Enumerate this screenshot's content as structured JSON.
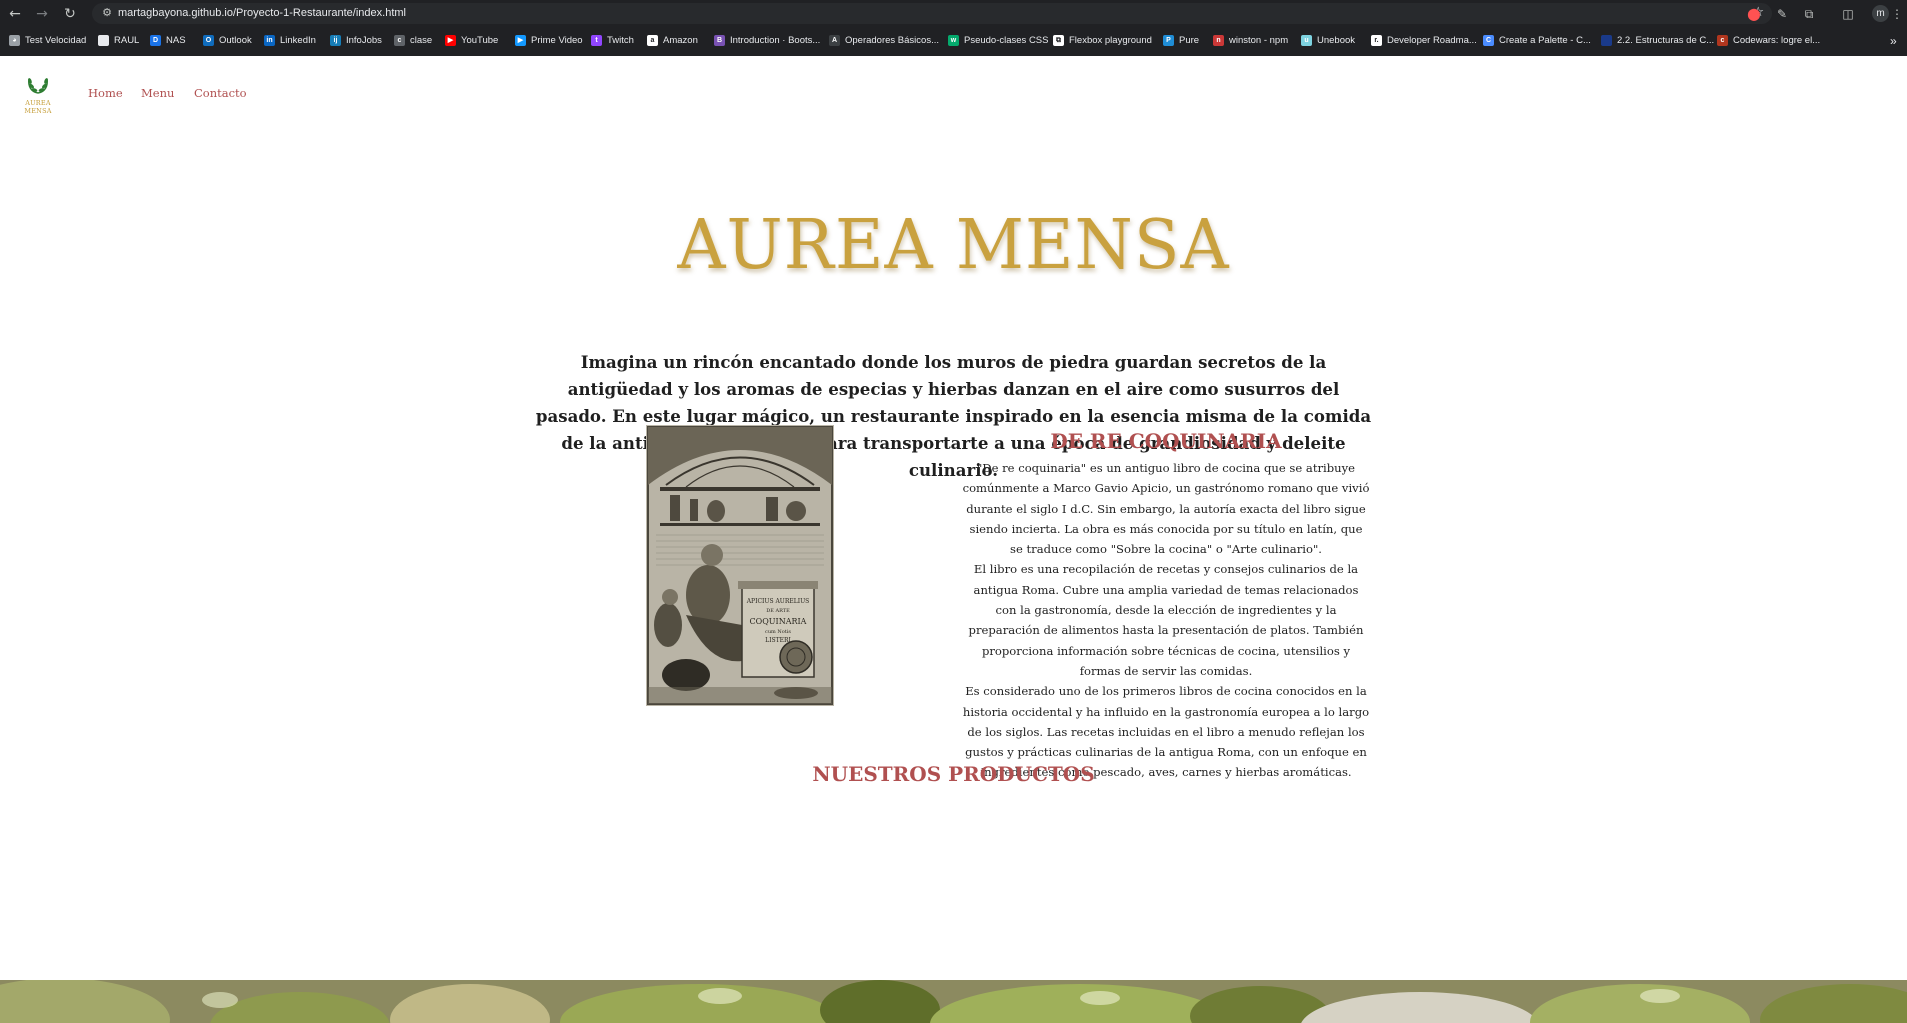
{
  "browser": {
    "url": "martagbayona.github.io/Proyecto-1-Restaurante/index.html",
    "profile_initial": "m",
    "bookmarks": [
      {
        "label": "Test Velocidad",
        "icon": "speedometer-icon",
        "color": "#9aa0a6"
      },
      {
        "label": "RAUL",
        "icon": "folder-icon",
        "color": "#e8eaed"
      },
      {
        "label": "NAS",
        "icon": "nas-icon",
        "color": "#1a73e8"
      },
      {
        "label": "Outlook",
        "icon": "outlook-icon",
        "color": "#0f6cbd"
      },
      {
        "label": "LinkedIn",
        "icon": "linkedin-icon",
        "color": "#0a66c2"
      },
      {
        "label": "InfoJobs",
        "icon": "infojobs-icon",
        "color": "#167db7"
      },
      {
        "label": "clase",
        "icon": "classroom-icon",
        "color": "#5f6368"
      },
      {
        "label": "YouTube",
        "icon": "youtube-icon",
        "color": "#ff0000"
      },
      {
        "label": "Prime Video",
        "icon": "prime-video-icon",
        "color": "#1399ff"
      },
      {
        "label": "Twitch",
        "icon": "twitch-icon",
        "color": "#9146ff"
      },
      {
        "label": "Amazon",
        "icon": "amazon-icon",
        "color": "#ffffff"
      },
      {
        "label": "Introduction · Boots...",
        "icon": "bootstrap-icon",
        "color": "#7952b3"
      },
      {
        "label": "Operadores Básicos...",
        "icon": "operators-icon",
        "color": "#3c4043"
      },
      {
        "label": "Pseudo-clases CSS",
        "icon": "w-icon",
        "color": "#04aa6d"
      },
      {
        "label": "Flexbox playground",
        "icon": "flexbox-icon",
        "color": "#ffffff"
      },
      {
        "label": "Pure",
        "icon": "pure-icon",
        "color": "#1f8dd6"
      },
      {
        "label": "winston - npm",
        "icon": "npm-icon",
        "color": "#cb3837"
      },
      {
        "label": "Unebook",
        "icon": "unebook-icon",
        "color": "#7ed3e0"
      },
      {
        "label": "Developer Roadma...",
        "icon": "roadmap-icon",
        "color": "#ffffff"
      },
      {
        "label": "Create a Palette - C...",
        "icon": "coolors-icon",
        "color": "#4a8cff"
      },
      {
        "label": "2.2. Estructuras de C...",
        "icon": "document-icon",
        "color": "#1a3a8a"
      },
      {
        "label": "Codewars: logre el...",
        "icon": "codewars-icon",
        "color": "#b1361e"
      }
    ]
  },
  "site": {
    "logo_text": "AUREA MENSA",
    "nav": [
      {
        "label": "Home"
      },
      {
        "label": "Menu"
      },
      {
        "label": "Contacto"
      }
    ],
    "hero_title": "AUREA MENSA",
    "intro": "Imagina un rincón encantado donde los muros de piedra guardan secretos de la antigüedad y los aromas de especias y hierbas danzan en el aire como susurros del pasado. En este lugar mágico, un restaurante inspirado en la esencia misma de la comida de la antigua Roma espera para transportarte a una época de grandiosidad y deleite culinario.",
    "book": {
      "title": "DE RE COQUINARIA",
      "plate_text": [
        "APICIUS AURELIUS",
        "DE ARTE",
        "COQUINARIA",
        "cum Notis",
        "LISTERI"
      ],
      "paragraphs": [
        "\"De re coquinaria\" es un antiguo libro de cocina que se atribuye comúnmente a Marco Gavio Apicio, un gastrónomo romano que vivió durante el siglo I d.C. Sin embargo, la autoría exacta del libro sigue siendo incierta. La obra es más conocida por su título en latín, que se traduce como \"Sobre la cocina\" o \"Arte culinario\".",
        "El libro es una recopilación de recetas y consejos culinarios de la antigua Roma. Cubre una amplia variedad de temas relacionados con la gastronomía, desde la elección de ingredientes y la preparación de alimentos hasta la presentación de platos. También proporciona información sobre técnicas de cocina, utensilios y formas de servir las comidas.",
        "Es considerado uno de los primeros libros de cocina conocidos en la historia occidental y ha influido en la gastronomía europea a lo largo de los siglos. Las recetas incluidas en el libro a menudo reflejan los gustos y prácticas culinarias de la antigua Roma, con un enfoque en ingredientes como pescado, aves, carnes y hierbas aromáticas."
      ]
    },
    "products_title": "NUESTROS PRODUCTOS",
    "colors": {
      "gold": "#c9a13f",
      "accent_red": "#b05050",
      "wreath_green": "#2e7d32"
    }
  }
}
